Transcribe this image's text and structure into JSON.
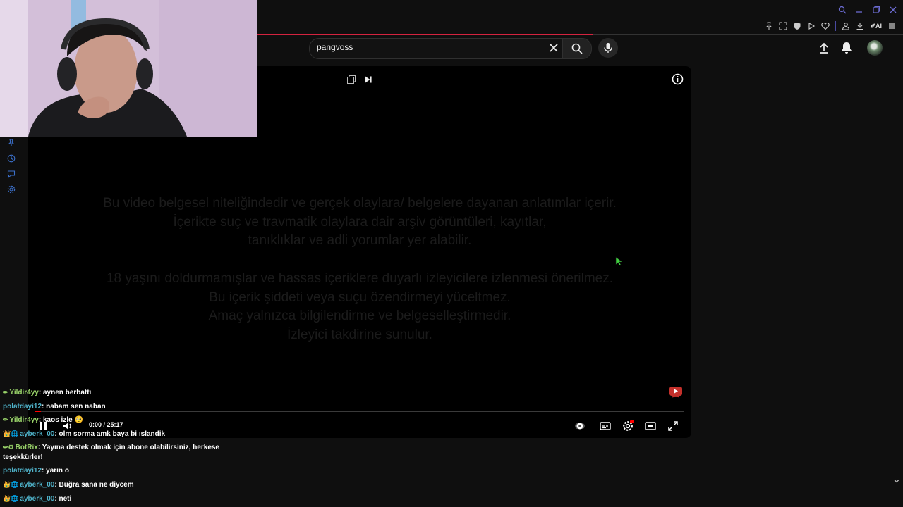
{
  "search": {
    "query": "pangvoss"
  },
  "player": {
    "time_display": "0:00 / 25:17",
    "progress_fraction": 0.0,
    "overlay_lines": [
      "Bu video belgesel niteliğindedir ve gerçek olaylara/ belgelere dayanan anlatımlar içerir.",
      "İçerikte suç ve travmatik olaylara dair arşiv görüntüleri, kayıtlar,",
      "tanıklıklar ve adli yorumlar yer alabilir.",
      "",
      "18 yaşını doldurmamışlar ve hassas içeriklere duyarlı izleyicilere izlenmesi önerilmez.",
      "Bu içerik şiddeti veya suçu özendirmeyi yüceltmez.",
      "Amaç yalnızca bilgilendirme ve belgeselleştirmedir.",
      "İzleyici takdirine sunulur."
    ]
  },
  "ext": {
    "ai_label": "AI"
  },
  "colors": {
    "accent": "#d4233f",
    "youtube_red": "#ff0000"
  },
  "chat": [
    {
      "user": "Yildir4yy",
      "sep": ": ",
      "msg": "aynen berbattı",
      "color": "#9ad46a",
      "badges": "✏"
    },
    {
      "user": "polatdayi12",
      "sep": ": ",
      "msg": "nabam sen naban",
      "color": "#4fb2c9",
      "badges": ""
    },
    {
      "user": "Yildir4yy",
      "sep": ": ",
      "msg": "kaos izle 🥺",
      "color": "#9ad46a",
      "badges": "✏"
    },
    {
      "user": "ayberk_00",
      "sep": ": ",
      "msg": "olm sorma amk baya bi ıslandik",
      "color": "#4fb2c9",
      "badges": "👑🌐"
    },
    {
      "user": "BotRix",
      "sep": ": ",
      "msg": "Yayına destek olmak için abone olabilirsiniz, herkese teşekkürler!",
      "color": "#9ad46a",
      "badges": "✏⚙"
    },
    {
      "user": "polatdayi12",
      "sep": ": ",
      "msg": "yarın o",
      "color": "#4fb2c9",
      "badges": ""
    },
    {
      "user": "ayberk_00",
      "sep": ": ",
      "msg": "Buğra sana ne diycem",
      "color": "#4fb2c9",
      "badges": "👑🌐"
    },
    {
      "user": "ayberk_00",
      "sep": ": ",
      "msg": "neti",
      "color": "#4fb2c9",
      "badges": "👑🌐"
    }
  ]
}
